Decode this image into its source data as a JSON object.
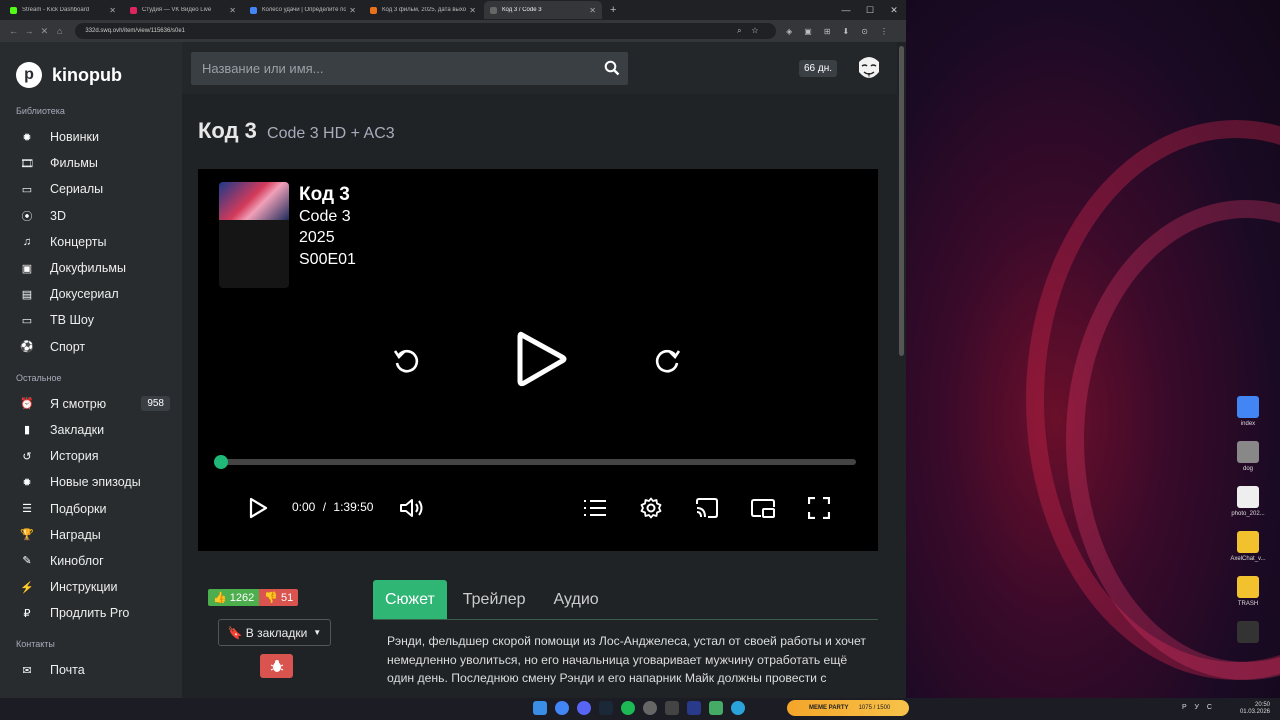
{
  "browser": {
    "tabs": [
      {
        "label": "Stream - Kick Dashboard",
        "color": "#53fc18"
      },
      {
        "label": "Студия — VK Видео Live",
        "color": "#e0245e"
      },
      {
        "label": "Колесо удачи | Определите по",
        "color": "#4285f4"
      },
      {
        "label": "Код 3 фильм, 2025, дата выхо",
        "color": "#e8711a"
      },
      {
        "label": "Код 3 / Code 3",
        "color": "#666666"
      }
    ],
    "new_tab": "+",
    "url": "332d.swq.ovh/item/view/115636/s0e1",
    "window": {
      "min": "—",
      "max": "☐",
      "close": "✕"
    }
  },
  "site": {
    "logo_text": "kinopub",
    "logo_mark": "p",
    "search_placeholder": "Название или имя...",
    "days_badge": "66 дн."
  },
  "sidebar": {
    "library_title": "Библиотека",
    "library_items": [
      {
        "label": "Новинки",
        "icon": "gear-icon"
      },
      {
        "label": "Фильмы",
        "icon": "film-icon"
      },
      {
        "label": "Сериалы",
        "icon": "monitor-icon"
      },
      {
        "label": "3D",
        "icon": "3d-icon"
      },
      {
        "label": "Концерты",
        "icon": "music-icon"
      },
      {
        "label": "Докуфильмы",
        "icon": "doc-film-icon"
      },
      {
        "label": "Докусериал",
        "icon": "doc-icon"
      },
      {
        "label": "ТВ Шоу",
        "icon": "tv-icon"
      },
      {
        "label": "Спорт",
        "icon": "ball-icon"
      }
    ],
    "other_title": "Остальное",
    "other_items": [
      {
        "label": "Я смотрю",
        "icon": "bell-icon",
        "badge": "958"
      },
      {
        "label": "Закладки",
        "icon": "bookmark-icon"
      },
      {
        "label": "История",
        "icon": "history-icon"
      },
      {
        "label": "Новые эпизоды",
        "icon": "gear-icon"
      },
      {
        "label": "Подборки",
        "icon": "list-icon"
      },
      {
        "label": "Награды",
        "icon": "trophy-icon"
      },
      {
        "label": "Киноблог",
        "icon": "blog-icon"
      },
      {
        "label": "Инструкции",
        "icon": "plug-icon"
      },
      {
        "label": "Продлить Pro",
        "icon": "ruble-icon"
      }
    ],
    "contacts_title": "Контакты",
    "contacts_items": [
      {
        "label": "Почта",
        "icon": "mail-icon"
      }
    ]
  },
  "page": {
    "title": "Код 3",
    "subtitle": "Code 3 HD + AC3"
  },
  "player": {
    "title_ru": "Код 3",
    "title_en": "Code 3",
    "year": "2025",
    "episode": "S00E01",
    "current_time": "0:00",
    "separator": "/",
    "duration": "1:39:50",
    "progress": 0.0
  },
  "rating": {
    "likes": "1262",
    "dislikes": "51"
  },
  "bookmark_label": "В закладки",
  "detail_tabs": [
    "Сюжет",
    "Трейлер",
    "Аудио"
  ],
  "description": "Рэнди, фельдшер скорой помощи из Лос-Анджелеса, устал от своей работы и хочет немедленно уволиться, но его начальница уговаривает мужчину отработать ещё один день. Последнюю смену Рэнди и его напарник Майк должны провести с",
  "desktop_icons": [
    {
      "label": "index",
      "color": "#4285f4"
    },
    {
      "label": "dog",
      "color": "#888888"
    },
    {
      "label": "photo_202...",
      "color": "#eeeeee"
    },
    {
      "label": "AxelChat_v...",
      "color": "#f2c12e"
    },
    {
      "label": "TRASH",
      "color": "#f2c12e"
    },
    {
      "label": "",
      "color": "#333333"
    }
  ],
  "taskbar": {
    "meme_label": "MEME PARTY",
    "meme_counter": "1075 / 1500",
    "lang": "РУС",
    "time": "20:50",
    "date": "01.03.2026"
  }
}
